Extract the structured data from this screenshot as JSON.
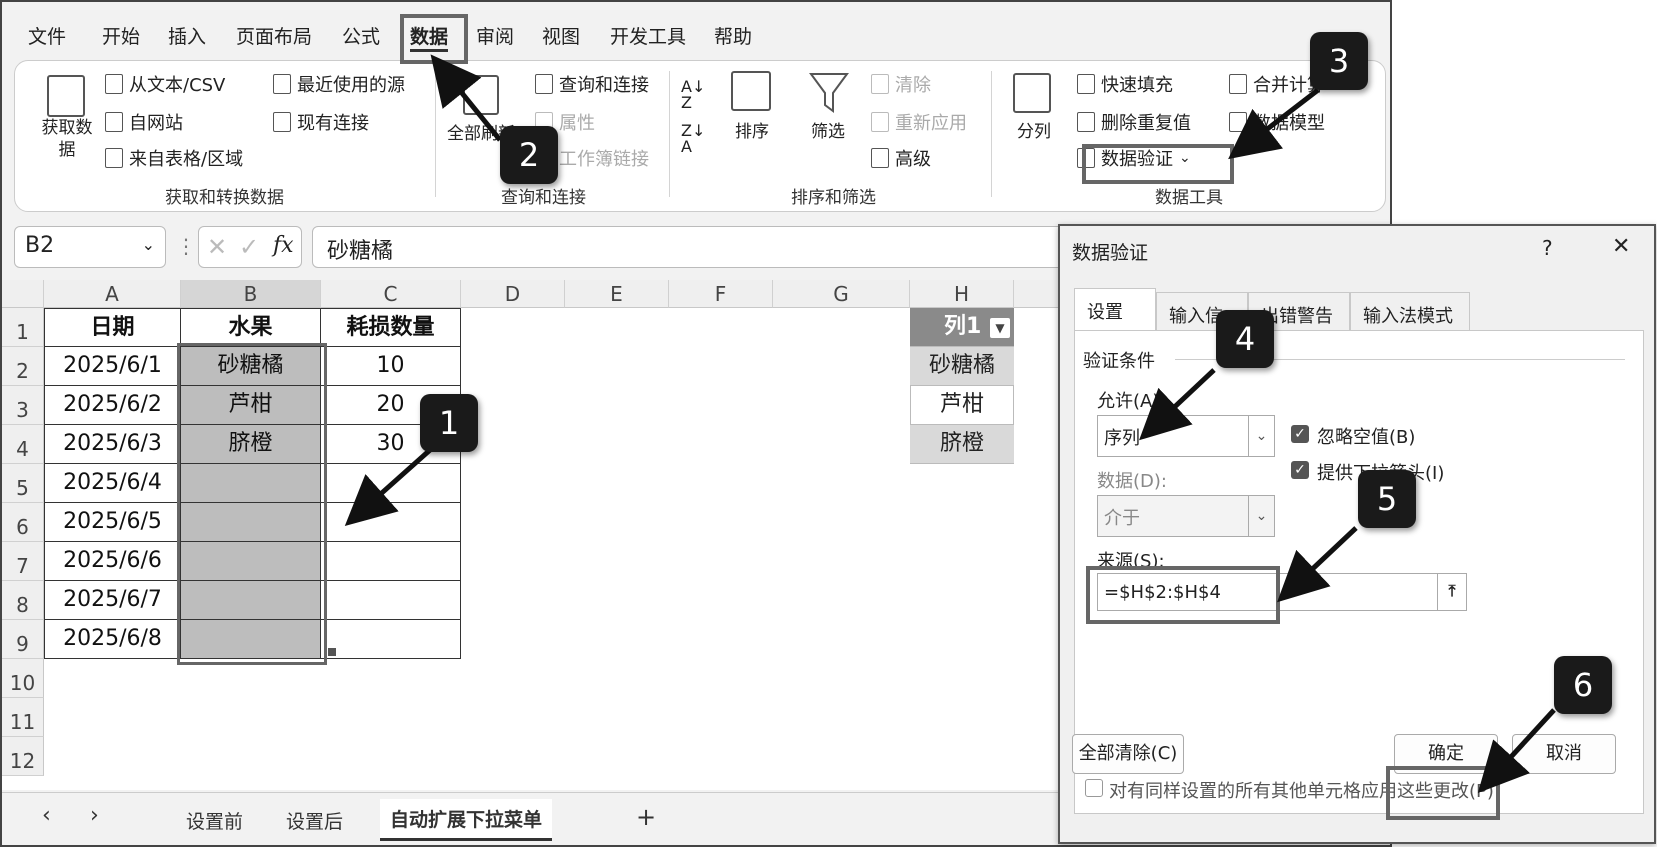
{
  "menu": [
    "文件",
    "开始",
    "插入",
    "页面布局",
    "公式",
    "数据",
    "审阅",
    "视图",
    "开发工具",
    "帮助"
  ],
  "ribbon": {
    "get_data": "获取数据",
    "from_text": "从文本/CSV",
    "from_web": "自网站",
    "from_table": "来自表格/区域",
    "recent_sources": "最近使用的源",
    "existing_connections": "现有连接",
    "group_get": "获取和转换数据",
    "refresh_all": "全部刷新",
    "queries_connections": "查询和连接",
    "properties": "属性",
    "workbook_links": "工作簿链接",
    "group_queries": "查询和连接",
    "sort": "排序",
    "filter": "筛选",
    "clear": "清除",
    "reapply": "重新应用",
    "advanced": "高级",
    "group_sort": "排序和筛选",
    "text_to_columns": "分列",
    "flash_fill": "快速填充",
    "remove_duplicates": "删除重复值",
    "data_validation": "数据验证",
    "consolidate": "合并计算",
    "data_model": "数据模型",
    "group_tools": "数据工具"
  },
  "formula_bar": {
    "cell_ref": "B2",
    "fx": "fx",
    "value": "砂糖橘"
  },
  "columns": [
    "A",
    "B",
    "C",
    "D",
    "E",
    "F",
    "G",
    "H"
  ],
  "rows": [
    "1",
    "2",
    "3",
    "4",
    "5",
    "6",
    "7",
    "8",
    "9",
    "10",
    "11",
    "12"
  ],
  "table": {
    "headers": [
      "日期",
      "水果",
      "耗损数量"
    ],
    "dates": [
      "2025/6/1",
      "2025/6/2",
      "2025/6/3",
      "2025/6/4",
      "2025/6/5",
      "2025/6/6",
      "2025/6/7",
      "2025/6/8"
    ],
    "fruits": [
      "砂糖橘",
      "芦柑",
      "脐橙",
      "",
      "",
      "",
      "",
      ""
    ],
    "losses": [
      "10",
      "20",
      "30",
      "",
      "",
      "",
      "",
      ""
    ]
  },
  "h_list": {
    "header": "列1",
    "items": [
      "砂糖橘",
      "芦柑",
      "脐橙"
    ]
  },
  "sheet_tabs": [
    "设置前",
    "设置后",
    "自动扩展下拉菜单"
  ],
  "dialog": {
    "title": "数据验证",
    "help": "?",
    "close": "✕",
    "tabs": [
      "设置",
      "输入信息",
      "出错警告",
      "输入法模式"
    ],
    "criteria": "验证条件",
    "allow_label": "允许(A):",
    "allow_value": "序列",
    "ignore_blank": "忽略空值(B)",
    "in_cell_dropdown": "提供下拉箭头(I)",
    "data_label": "数据(D):",
    "data_value": "介于",
    "source_label": "来源(S):",
    "source_value": "=$H$2:$H$4",
    "apply_all": "对有同样设置的所有其他单元格应用这些更改(P)",
    "clear_all": "全部清除(C)",
    "ok": "确定",
    "cancel": "取消"
  },
  "callouts": [
    "1",
    "2",
    "3",
    "4",
    "5",
    "6"
  ],
  "colors": {
    "highlight": "#666666",
    "badge": "#1a1a1a",
    "selection": "#bdbdbd"
  }
}
